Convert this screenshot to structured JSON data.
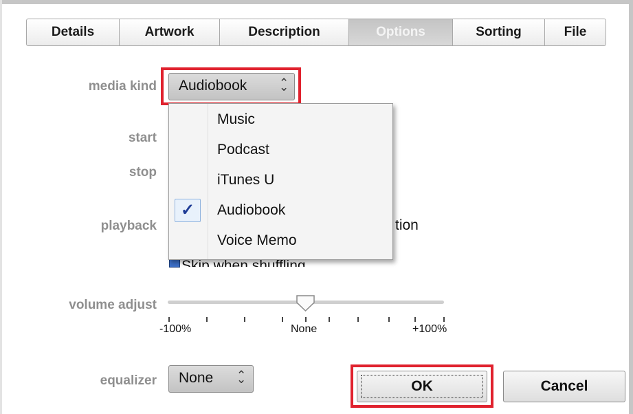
{
  "tabs": [
    "Details",
    "Artwork",
    "Description",
    "Options",
    "Sorting",
    "File"
  ],
  "selected_tab": "Options",
  "labels": {
    "media_kind": "media kind",
    "start": "start",
    "stop": "stop",
    "playback": "playback",
    "volume_adjust": "volume adjust",
    "equalizer": "equalizer"
  },
  "media_kind": {
    "value": "Audiobook",
    "options": [
      "Music",
      "Podcast",
      "iTunes U",
      "Audiobook",
      "Voice Memo"
    ],
    "checked": "Audiobook"
  },
  "playback_partial": {
    "remember_position_tail": "tion",
    "skip_when_shuffling": "Skip when shuffling"
  },
  "volume": {
    "value": "None",
    "ticks": [
      "-100%",
      "None",
      "+100%"
    ]
  },
  "equalizer": {
    "value": "None"
  },
  "buttons": {
    "ok": "OK",
    "cancel": "Cancel"
  },
  "icons": {
    "select_chevron": "up-down-chevron-icon",
    "checkmark": "checkmark-icon"
  },
  "colors": {
    "highlight": "#e0222e",
    "check": "#1f3c96"
  }
}
